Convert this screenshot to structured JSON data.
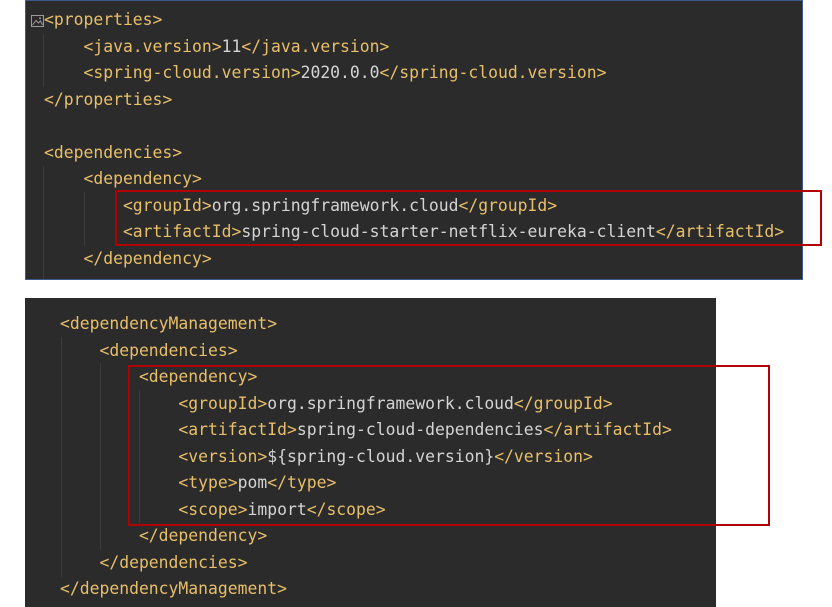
{
  "colors": {
    "page_background": "#ffffff",
    "editor_background": "#2b2b2b",
    "xml_tag": "#e8bf6a",
    "xml_text": "#d4d4d4",
    "highlight_box": "#b00000",
    "panel_border": "#3e5a86",
    "indent_guide": "#3c3c3c"
  },
  "icons": {
    "gutter": "image-icon"
  },
  "panels": [
    {
      "lines": [
        {
          "indent": 0,
          "tokens": [
            {
              "type": "tag",
              "value": "<properties>"
            }
          ]
        },
        {
          "indent": 1,
          "tokens": [
            {
              "type": "tag",
              "value": "<java.version>"
            },
            {
              "type": "text",
              "value": "11"
            },
            {
              "type": "tag",
              "value": "</java.version>"
            }
          ]
        },
        {
          "indent": 1,
          "tokens": [
            {
              "type": "tag",
              "value": "<spring-cloud.version>"
            },
            {
              "type": "text",
              "value": "2020.0.0"
            },
            {
              "type": "tag",
              "value": "</spring-cloud.version>"
            }
          ]
        },
        {
          "indent": 0,
          "tokens": [
            {
              "type": "tag",
              "value": "</properties>"
            }
          ]
        },
        {
          "indent": 0,
          "tokens": []
        },
        {
          "indent": 0,
          "tokens": [
            {
              "type": "tag",
              "value": "<dependencies>"
            }
          ]
        },
        {
          "indent": 1,
          "tokens": [
            {
              "type": "tag",
              "value": "<dependency>"
            }
          ]
        },
        {
          "indent": 2,
          "tokens": [
            {
              "type": "tag",
              "value": "<groupId>"
            },
            {
              "type": "text",
              "value": "org.springframework.cloud"
            },
            {
              "type": "tag",
              "value": "</groupId>"
            }
          ]
        },
        {
          "indent": 2,
          "tokens": [
            {
              "type": "tag",
              "value": "<artifactId>"
            },
            {
              "type": "text",
              "value": "spring-cloud-starter-netflix-eureka-client"
            },
            {
              "type": "tag",
              "value": "</artifactId>"
            }
          ]
        },
        {
          "indent": 1,
          "tokens": [
            {
              "type": "tag",
              "value": "</dependency>"
            }
          ]
        }
      ]
    },
    {
      "lines": [
        {
          "indent": 0,
          "tokens": [
            {
              "type": "tag",
              "value": "<dependencyManagement>"
            }
          ]
        },
        {
          "indent": 1,
          "tokens": [
            {
              "type": "tag",
              "value": "<dependencies>"
            }
          ]
        },
        {
          "indent": 2,
          "tokens": [
            {
              "type": "tag",
              "value": "<dependency>"
            }
          ]
        },
        {
          "indent": 3,
          "tokens": [
            {
              "type": "tag",
              "value": "<groupId>"
            },
            {
              "type": "text",
              "value": "org.springframework.cloud"
            },
            {
              "type": "tag",
              "value": "</groupId>"
            }
          ]
        },
        {
          "indent": 3,
          "tokens": [
            {
              "type": "tag",
              "value": "<artifactId>"
            },
            {
              "type": "text",
              "value": "spring-cloud-dependencies"
            },
            {
              "type": "tag",
              "value": "</artifactId>"
            }
          ]
        },
        {
          "indent": 3,
          "tokens": [
            {
              "type": "tag",
              "value": "<version>"
            },
            {
              "type": "text",
              "value": "${spring-cloud.version}"
            },
            {
              "type": "tag",
              "value": "</version>"
            }
          ]
        },
        {
          "indent": 3,
          "tokens": [
            {
              "type": "tag",
              "value": "<type>"
            },
            {
              "type": "text",
              "value": "pom"
            },
            {
              "type": "tag",
              "value": "</type>"
            }
          ]
        },
        {
          "indent": 3,
          "tokens": [
            {
              "type": "tag",
              "value": "<scope>"
            },
            {
              "type": "text",
              "value": "import"
            },
            {
              "type": "tag",
              "value": "</scope>"
            }
          ]
        },
        {
          "indent": 2,
          "tokens": [
            {
              "type": "tag",
              "value": "</dependency>"
            }
          ]
        },
        {
          "indent": 1,
          "tokens": [
            {
              "type": "tag",
              "value": "</dependencies>"
            }
          ]
        },
        {
          "indent": 0,
          "tokens": [
            {
              "type": "tag",
              "value": "</dependencyManagement>"
            }
          ]
        }
      ]
    }
  ]
}
